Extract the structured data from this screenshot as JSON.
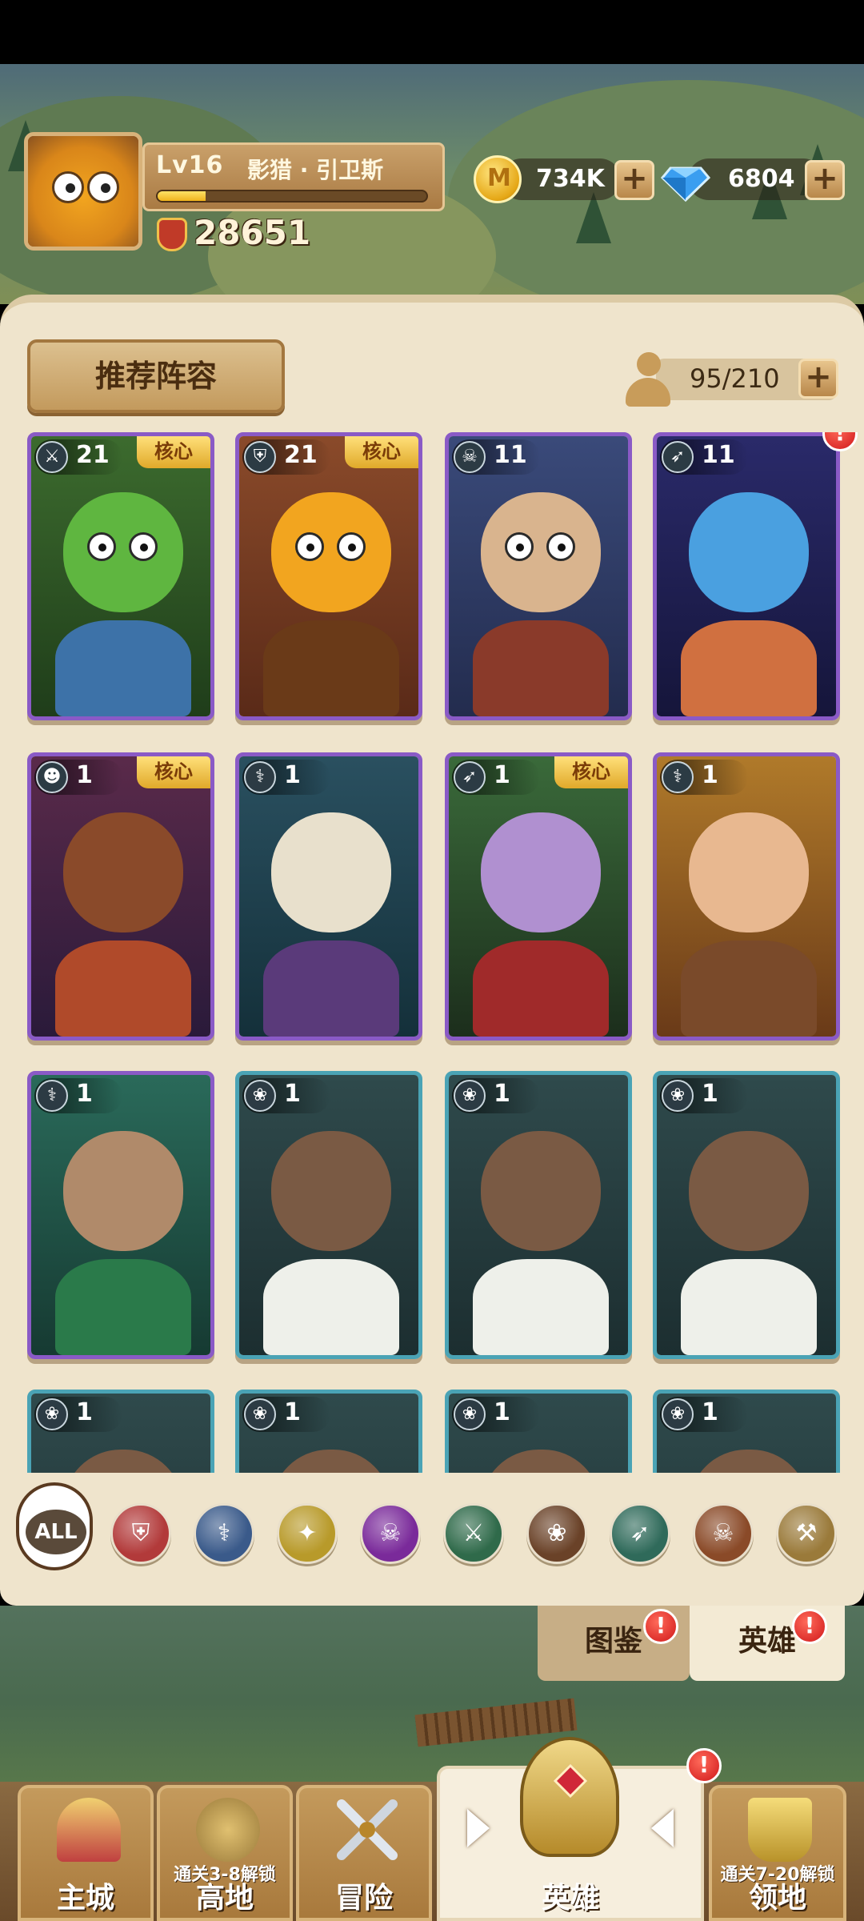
{
  "player": {
    "level": "Lv16",
    "name": "影猎 · 引卫斯",
    "xp_progress": 0.18,
    "power": "28651"
  },
  "currency": {
    "gold": "734K",
    "gems": "6804",
    "coin_symbol": "M"
  },
  "panel": {
    "recommend_label": "推荐阵容",
    "roster": "95/210"
  },
  "cards": [
    {
      "level": "1"
    },
    {
      "level": "1"
    },
    {
      "level": "1"
    }
  ],
  "heroes": [
    {
      "level": "21",
      "core": "核心",
      "class_icon": "crossed-swords-icon",
      "frame": "purple",
      "art": "green-orc",
      "alert": ""
    },
    {
      "level": "21",
      "core": "核心",
      "class_icon": "shield-icon",
      "frame": "purple",
      "art": "orange-bug",
      "alert": ""
    },
    {
      "level": "11",
      "core": "",
      "class_icon": "horned-skull-icon",
      "frame": "purple",
      "art": "pig-warrior",
      "alert": ""
    },
    {
      "level": "11",
      "core": "",
      "class_icon": "bow-icon",
      "frame": "purple",
      "art": "blue-fish",
      "alert": "!"
    },
    {
      "level": "1",
      "core": "核心",
      "class_icon": "monkey-icon",
      "frame": "purple",
      "art": "boar-beast",
      "alert": ""
    },
    {
      "level": "1",
      "core": "",
      "class_icon": "staff-icon",
      "frame": "purple",
      "art": "hooded-mage",
      "alert": ""
    },
    {
      "level": "1",
      "core": "核心",
      "class_icon": "bow-icon",
      "frame": "purple",
      "art": "elf-queen",
      "alert": ""
    },
    {
      "level": "1",
      "core": "",
      "class_icon": "staff-icon",
      "frame": "purple",
      "art": "dark-hair-girl",
      "alert": ""
    },
    {
      "level": "1",
      "core": "",
      "class_icon": "staff-icon",
      "frame": "purple",
      "art": "green-sorceress",
      "alert": ""
    },
    {
      "level": "1",
      "core": "",
      "class_icon": "paw-icon",
      "frame": "teal",
      "art": "buffalo-chef",
      "alert": ""
    },
    {
      "level": "1",
      "core": "",
      "class_icon": "paw-icon",
      "frame": "teal",
      "art": "buffalo-chef",
      "alert": ""
    },
    {
      "level": "1",
      "core": "",
      "class_icon": "paw-icon",
      "frame": "teal",
      "art": "buffalo-chef",
      "alert": ""
    },
    {
      "level": "1",
      "core": "",
      "class_icon": "paw-icon",
      "frame": "teal",
      "art": "buffalo-chef",
      "alert": ""
    },
    {
      "level": "1",
      "core": "",
      "class_icon": "paw-icon",
      "frame": "teal",
      "art": "buffalo-chef",
      "alert": ""
    },
    {
      "level": "1",
      "core": "",
      "class_icon": "paw-icon",
      "frame": "teal",
      "art": "buffalo-chef",
      "alert": ""
    },
    {
      "level": "1",
      "core": "",
      "class_icon": "paw-icon",
      "frame": "teal",
      "art": "buffalo-chef",
      "alert": ""
    }
  ],
  "filters": {
    "all_label": "ALL",
    "items": [
      {
        "icon": "shield-icon",
        "color": "#b23a3a"
      },
      {
        "icon": "staff-icon",
        "color": "#3a5a8a"
      },
      {
        "icon": "eagle-icon",
        "color": "#b89a2a"
      },
      {
        "icon": "skull-icon",
        "color": "#7a2a9a"
      },
      {
        "icon": "crossed-swords-icon",
        "color": "#2f6a4a"
      },
      {
        "icon": "paw-icon",
        "color": "#6a4228"
      },
      {
        "icon": "bow-icon",
        "color": "#2f6a5a"
      },
      {
        "icon": "horned-skull-icon",
        "color": "#8a4a28"
      },
      {
        "icon": "hammer-icon",
        "color": "#9a7a3a"
      }
    ]
  },
  "sub_tabs": {
    "codex": "图鉴",
    "heroes": "英雄",
    "alert": "!"
  },
  "nav": {
    "main_city": "主城",
    "highland": "高地",
    "highland_lock": "通关3-8解锁",
    "adventure": "冒险",
    "heroes": "英雄",
    "territory": "领地",
    "territory_lock": "通关7-20解锁",
    "alert": "!"
  }
}
